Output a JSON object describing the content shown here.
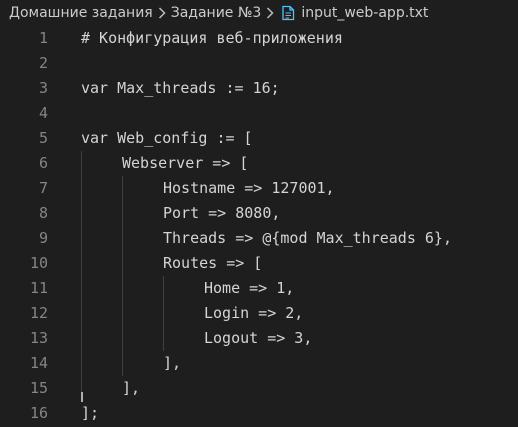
{
  "breadcrumb": {
    "folder": "Домашние задания",
    "subfolder": "Задание №3",
    "file": "input_web-app.txt"
  },
  "editor": {
    "lines": [
      {
        "n": "1",
        "indent": 0,
        "text": "# Конфигурация веб-приложения"
      },
      {
        "n": "2",
        "indent": 0,
        "text": ""
      },
      {
        "n": "3",
        "indent": 0,
        "text": "var Max_threads := 16;"
      },
      {
        "n": "4",
        "indent": 0,
        "text": ""
      },
      {
        "n": "5",
        "indent": 0,
        "text": "var Web_config := ["
      },
      {
        "n": "6",
        "indent": 1,
        "text": "Webserver => ["
      },
      {
        "n": "7",
        "indent": 2,
        "text": "Hostname => 127001,"
      },
      {
        "n": "8",
        "indent": 2,
        "text": "Port => 8080,"
      },
      {
        "n": "9",
        "indent": 2,
        "text": "Threads => @{mod Max_threads 6},"
      },
      {
        "n": "10",
        "indent": 2,
        "text": "Routes => ["
      },
      {
        "n": "11",
        "indent": 3,
        "text": "Home => 1,"
      },
      {
        "n": "12",
        "indent": 3,
        "text": "Login => 2,"
      },
      {
        "n": "13",
        "indent": 3,
        "text": "Logout => 3,"
      },
      {
        "n": "14",
        "indent": 2,
        "text": "],"
      },
      {
        "n": "15",
        "indent": 1,
        "text": "],"
      },
      {
        "n": "16",
        "indent": 0,
        "text": "];"
      }
    ]
  },
  "colors": {
    "background": "#1e1e1e",
    "text": "#d4d4d4",
    "line_number": "#858585",
    "file_icon": "#4fc1ff"
  },
  "icons": [
    "chevron-right-icon",
    "file-text-icon"
  ]
}
